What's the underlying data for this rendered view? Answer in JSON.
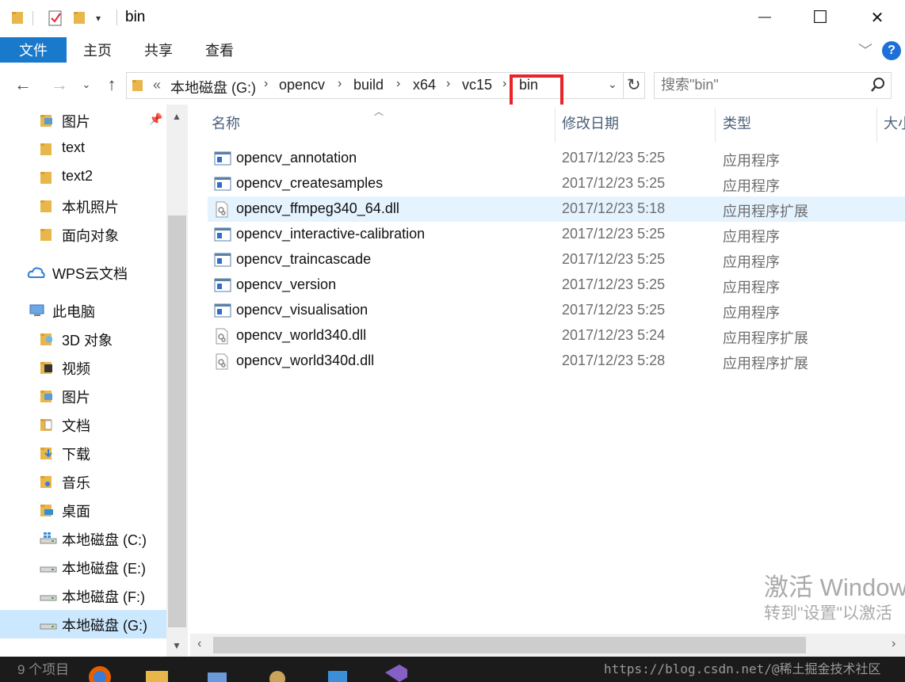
{
  "window": {
    "title": "bin",
    "minimize": "—",
    "maximize": "☐",
    "close": "✕"
  },
  "ribbon": {
    "tabs": [
      "文件",
      "主页",
      "共享",
      "查看"
    ],
    "help": "?"
  },
  "address": {
    "overflow": "«",
    "crumbs": [
      "本地磁盘 (G:)",
      "opencv",
      "build",
      "x64",
      "vc15",
      "bin"
    ],
    "search_placeholder": "搜索\"bin\""
  },
  "nav": {
    "items": [
      {
        "label": "图片",
        "icon": "pictures-folder-icon",
        "pinned": true
      },
      {
        "label": "text",
        "icon": "folder-icon"
      },
      {
        "label": "text2",
        "icon": "folder-icon"
      },
      {
        "label": "本机照片",
        "icon": "folder-icon"
      },
      {
        "label": "面向对象",
        "icon": "folder-icon"
      },
      {
        "label": "WPS云文档",
        "icon": "cloud-icon"
      },
      {
        "label": "此电脑",
        "icon": "computer-icon"
      },
      {
        "label": "3D 对象",
        "icon": "3d-objects-folder-icon"
      },
      {
        "label": "视频",
        "icon": "videos-folder-icon"
      },
      {
        "label": "图片",
        "icon": "pictures-folder-icon"
      },
      {
        "label": "文档",
        "icon": "documents-folder-icon"
      },
      {
        "label": "下载",
        "icon": "downloads-folder-icon"
      },
      {
        "label": "音乐",
        "icon": "music-folder-icon"
      },
      {
        "label": "桌面",
        "icon": "desktop-folder-icon"
      },
      {
        "label": "本地磁盘 (C:)",
        "icon": "windows-drive-icon"
      },
      {
        "label": "本地磁盘 (E:)",
        "icon": "drive-icon"
      },
      {
        "label": "本地磁盘 (F:)",
        "icon": "drive-icon"
      },
      {
        "label": "本地磁盘 (G:)",
        "icon": "drive-icon",
        "selected": true
      }
    ]
  },
  "filelist": {
    "columns": [
      "名称",
      "修改日期",
      "类型",
      "大小"
    ],
    "rows": [
      {
        "name": "opencv_annotation",
        "date": "2017/12/23 5:25",
        "type": "应用程序",
        "icon": "exe-icon"
      },
      {
        "name": "opencv_createsamples",
        "date": "2017/12/23 5:25",
        "type": "应用程序",
        "icon": "exe-icon"
      },
      {
        "name": "opencv_ffmpeg340_64.dll",
        "date": "2017/12/23 5:18",
        "type": "应用程序扩展",
        "icon": "dll-icon"
      },
      {
        "name": "opencv_interactive-calibration",
        "date": "2017/12/23 5:25",
        "type": "应用程序",
        "icon": "exe-icon"
      },
      {
        "name": "opencv_traincascade",
        "date": "2017/12/23 5:25",
        "type": "应用程序",
        "icon": "exe-icon"
      },
      {
        "name": "opencv_version",
        "date": "2017/12/23 5:25",
        "type": "应用程序",
        "icon": "exe-icon"
      },
      {
        "name": "opencv_visualisation",
        "date": "2017/12/23 5:25",
        "type": "应用程序",
        "icon": "exe-icon"
      },
      {
        "name": "opencv_world340.dll",
        "date": "2017/12/23 5:24",
        "type": "应用程序扩展",
        "icon": "dll-icon"
      },
      {
        "name": "opencv_world340d.dll",
        "date": "2017/12/23 5:28",
        "type": "应用程序扩展",
        "icon": "dll-icon"
      }
    ]
  },
  "watermark": {
    "line1": "激活 Windows",
    "line2": "转到\"设置\"以激活"
  },
  "status": {
    "count": "9 个项目",
    "url": "https://blog.csdn.net/@稀土掘金技术社区"
  },
  "colors": {
    "accent": "#1979ca",
    "highlight_box": "#e8232a",
    "selection": "#cce8ff",
    "hover": "#e5f3ff"
  }
}
